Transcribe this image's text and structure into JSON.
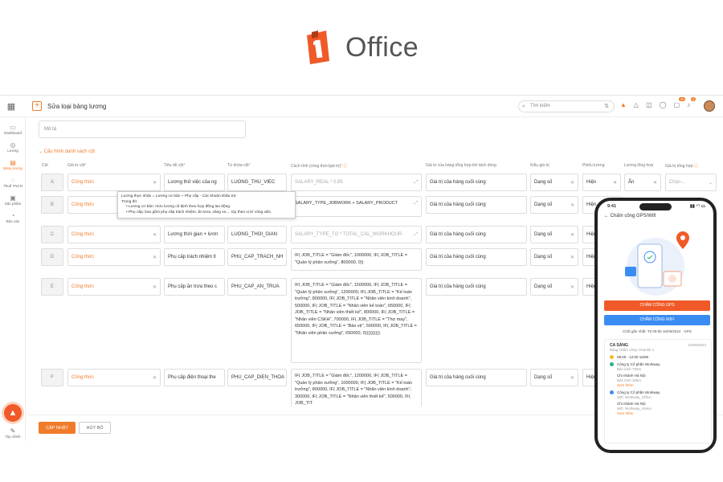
{
  "logo": {
    "text": "Office"
  },
  "topbar": {
    "title": "Sửa loại bảng lương",
    "search_placeholder": "Tìm kiếm",
    "badge1": "99",
    "badge2": "5"
  },
  "sidebar": {
    "items": [
      {
        "label": "Dashboard",
        "icon": "dashboard-icon"
      },
      {
        "label": "Lương",
        "icon": "coin-icon"
      },
      {
        "label": "Bảng lương",
        "icon": "table-icon"
      },
      {
        "label": "Thuế TNCN",
        "icon": "tax-icon"
      },
      {
        "label": "Sản phẩm",
        "icon": "product-icon"
      },
      {
        "label": "Báo cáo",
        "icon": "report-icon"
      }
    ],
    "bottom_label": "Tay chỉnh"
  },
  "form": {
    "mota_placeholder": "Mô tả",
    "section_title": "Cấu hình danh sách cột"
  },
  "columns": [
    "Cột",
    "Giá trị cột",
    "Tiêu đề cột",
    "Từ khóa cột",
    "Cách tính (công thức/giá trị)",
    "Giá trị của hàng tổng hợp khi tách dòng",
    "Kiểu giá trị",
    "Phiếu lương",
    "Lương tổng hợp",
    "Giá trị tổng hợp"
  ],
  "rows": [
    {
      "col": "A",
      "type": "Công thức",
      "title": "Lương thử việc của ng",
      "key": "LUONG_THU_VIEC",
      "formula": "SALARY_REAL * 0.85",
      "summary": "Giá trị của hàng cuối cùng",
      "kind": "Dạng số",
      "slip": "Hiện",
      "total": "Ẩn",
      "agg": "Chọn..."
    },
    {
      "col": "B",
      "type": "Công thức",
      "title": "",
      "key": "",
      "formula": "SALARY_TYPE_JOBWORK + SALARY_PRODUCT",
      "summary": "Giá trị của hàng cuối cùng",
      "kind": "Dạng số",
      "slip": "Hiện",
      "total": "",
      "agg": ""
    },
    {
      "col": "C",
      "type": "Công thức",
      "title": "Lương thời gian + lươn",
      "key": "LUONG_THOI_GIAN",
      "formula": "SALARY_TYPE_TG * TOTAL_CAL_WORKHOUR",
      "summary": "Giá trị của hàng cuối cùng",
      "kind": "Dạng số",
      "slip": "Hiện",
      "total": "",
      "agg": ""
    },
    {
      "col": "D",
      "type": "Công thức",
      "title": "Phụ cấp trách nhiệm tl",
      "key": "PHU_CAP_TRACH_NH",
      "formula": "IF( JOB_TITLE = \"Giám đốc\", 1000000, IF( JOB_TITLE = \"Quản lý phân xưởng\", 800000, 0))",
      "summary": "Giá trị của hàng cuối cùng",
      "kind": "Dạng số",
      "slip": "Hiện",
      "total": "",
      "agg": ""
    },
    {
      "col": "E",
      "type": "Công thức",
      "title": "Phụ cấp ăn trưa theo c",
      "key": "PHU_CAP_AN_TRUA",
      "formula": "IF( JOB_TITLE = \"Giám đốc\", 1500000, IF( JOB_TITLE = \"Quản lý phân xưởng\", 1200000, IF( JOB_TITLE = \"Kế toán trưởng\", 800000, IF( JOB_TITLE = \"Nhân viên kinh doanh\", 500000, IF( JOB_TITLE = \"Nhân viên kế toán\", 650000, IF( JOB_TITLE = \"Nhân viên thiết kế\", 800000, IF( JOB_TITLE = \"Nhân viên CSKH\", 700000, IF( JOB_TITLE = \"Thợ may\", 650000, IF( JOB_TITLE = \"Bảo vệ\", 500000, IF( JOB_TITLE = \"Nhân viên phân xưởng\", 650000, 0))))))))))",
      "summary": "Giá trị của hàng cuối cùng",
      "kind": "Dạng số",
      "slip": "Hiện",
      "total": "",
      "agg": ""
    },
    {
      "col": "F",
      "type": "Công thức",
      "title": "Phụ cấp điện thoại the",
      "key": "PHU_CAP_DIEN_THOA",
      "formula": "IF( JOB_TITLE = \"Giám đốc\", 1200000, IF( JOB_TITLE = \"Quản lý phân xưởng\", 1000000, IF( JOB_TITLE = \"Kế toán trưởng\", 800000, IF( JOB_TITLE = \"Nhân viên kinh doanh\", 300000, IF( JOB_TITLE = \"Nhân viên thiết kế\", 500000, IF( JOB_TIT",
      "summary": "Giá trị của hàng cuối cùng",
      "kind": "Dạng số",
      "slip": "Hiện",
      "total": "",
      "agg": ""
    }
  ],
  "tooltip": {
    "line1": "Lương thực nhận = Lương cơ bản + Phụ cấp - Các khoản khấu trừ",
    "line2": "Trong đó:",
    "line3": "• Lương cơ bản: mức lương cố định theo hợp đồng lao động.",
    "line4": "• Phụ cấp: bao gồm phụ cấp trách nhiệm, ăn trưa, xăng xe,... tùy theo vị trí công việc."
  },
  "footer": {
    "save": "CẬP NHẬT",
    "cancel": "HỦY BỎ"
  },
  "phone": {
    "time": "9:41",
    "title": "Chấm công GPS/Wifi",
    "btn_gps": "CHẤM CÔNG GPS",
    "btn_wifi": "CHẤM CÔNG WIFI",
    "last": "Chốt gần nhất: T6 09:59 16/08/2024 · GPS",
    "shift": "CA SÁNG",
    "date": "16/08/2024",
    "shift_sub": "Bảng chấm công Vmanhk 1",
    "shift_time": "08:00 - 12:00 16/08",
    "company1": "Công ty Cổ phần Workway",
    "company1_sub": "Bán kính 700m",
    "branch1": "Chi nhánh Hà Nội",
    "branch1_sub": "Bán kính 30km",
    "more": "Xem thêm",
    "company2": "Công ty Cổ phần Workway",
    "company2_sub": "Wifi: Workway_Office",
    "branch2": "Chi nhánh Hà Nội",
    "branch2_sub": "Wifi: Workway_Hanoi",
    "more2": "Xem thêm"
  }
}
